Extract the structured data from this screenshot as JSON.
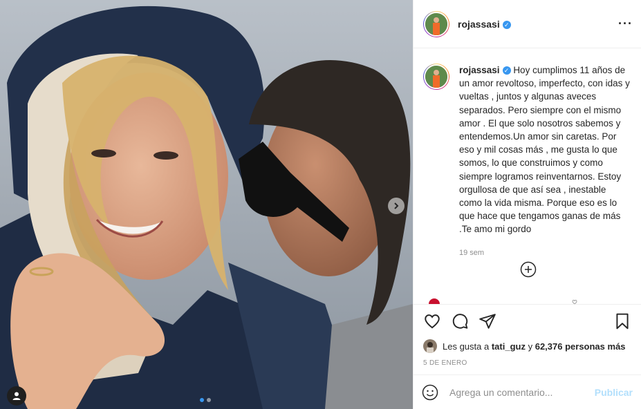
{
  "post": {
    "username": "rojassasi",
    "verified_icon": "verified-badge-icon",
    "caption": "Hoy cumplimos 11 años de un amor revoltoso, imperfecto, con idas y vueltas , juntos y algunas aveces separados. Pero siempre con el mismo amor . El que solo nosotros sabemos y entendemos.Un amor sin caretas. Por eso y mil cosas más , me gusta lo que somos, lo que construimos y como siempre logramos reinventarnos. Estoy orgullosa de que así sea , inestable como la vida misma. Porque eso es lo que hace que tengamos ganas de más .Te amo mi gordo",
    "time_ago": "19 sem",
    "likes": {
      "prefix": "Les gusta a",
      "user": "tati_guz",
      "joiner": "y",
      "count_text": "62,376 personas más"
    },
    "date": "5 DE ENERO",
    "comment_placeholder": "Agrega un comentario...",
    "publish_label": "Publicar",
    "carousel": {
      "total": 2,
      "current": 1
    }
  },
  "colors": {
    "link_blue": "#3897f0",
    "publish_disabled": "#b2dffc",
    "muted": "#8e8e8e",
    "text": "#262626"
  }
}
